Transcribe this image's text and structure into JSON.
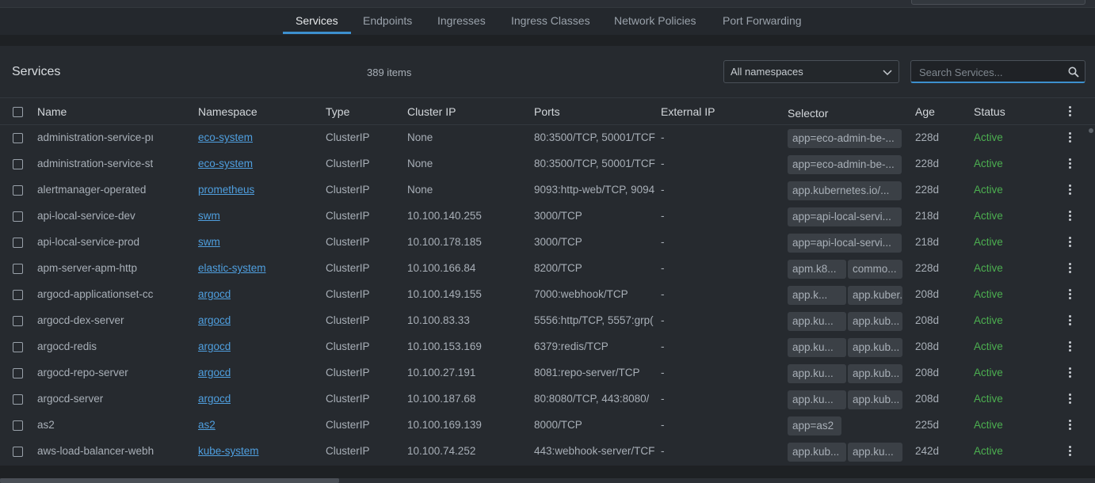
{
  "tabs": [
    {
      "label": "Services",
      "active": true
    },
    {
      "label": "Endpoints",
      "active": false
    },
    {
      "label": "Ingresses",
      "active": false
    },
    {
      "label": "Ingress Classes",
      "active": false
    },
    {
      "label": "Network Policies",
      "active": false
    },
    {
      "label": "Port Forwarding",
      "active": false
    }
  ],
  "toolbar": {
    "title": "Services",
    "count": "389 items",
    "namespace_select": "All namespaces",
    "search_placeholder": "Search Services..."
  },
  "table": {
    "columns": [
      "Name",
      "Namespace",
      "Type",
      "Cluster IP",
      "Ports",
      "External IP",
      "Selector",
      "Age",
      "Status"
    ],
    "rows": [
      {
        "name": "administration-service-pı",
        "namespace": "eco-system",
        "type": "ClusterIP",
        "cluster_ip": "None",
        "ports": "80:3500/TCP, 50001/TCF",
        "external_ip": "-",
        "selector": [
          "app=eco-admin-be-..."
        ],
        "age": "228d",
        "status": "Active"
      },
      {
        "name": "administration-service-st",
        "namespace": "eco-system",
        "type": "ClusterIP",
        "cluster_ip": "None",
        "ports": "80:3500/TCP, 50001/TCF",
        "external_ip": "-",
        "selector": [
          "app=eco-admin-be-..."
        ],
        "age": "228d",
        "status": "Active"
      },
      {
        "name": "alertmanager-operated",
        "namespace": "prometheus",
        "type": "ClusterIP",
        "cluster_ip": "None",
        "ports": "9093:http-web/TCP, 9094",
        "external_ip": "-",
        "selector": [
          "app.kubernetes.io/..."
        ],
        "age": "228d",
        "status": "Active"
      },
      {
        "name": "api-local-service-dev",
        "namespace": "swm",
        "type": "ClusterIP",
        "cluster_ip": "10.100.140.255",
        "ports": "3000/TCP",
        "external_ip": "-",
        "selector": [
          "app=api-local-servi..."
        ],
        "age": "218d",
        "status": "Active"
      },
      {
        "name": "api-local-service-prod",
        "namespace": "swm",
        "type": "ClusterIP",
        "cluster_ip": "10.100.178.185",
        "ports": "3000/TCP",
        "external_ip": "-",
        "selector": [
          "app=api-local-servi..."
        ],
        "age": "218d",
        "status": "Active"
      },
      {
        "name": "apm-server-apm-http",
        "namespace": "elastic-system",
        "type": "ClusterIP",
        "cluster_ip": "10.100.166.84",
        "ports": "8200/TCP",
        "external_ip": "-",
        "selector": [
          "apm.k8...",
          "commo..."
        ],
        "age": "228d",
        "status": "Active"
      },
      {
        "name": "argocd-applicationset-cc",
        "namespace": "argocd",
        "type": "ClusterIP",
        "cluster_ip": "10.100.149.155",
        "ports": "7000:webhook/TCP",
        "external_ip": "-",
        "selector": [
          "app.k...",
          "app.kuber..."
        ],
        "age": "208d",
        "status": "Active"
      },
      {
        "name": "argocd-dex-server",
        "namespace": "argocd",
        "type": "ClusterIP",
        "cluster_ip": "10.100.83.33",
        "ports": "5556:http/TCP, 5557:grp(",
        "external_ip": "-",
        "selector": [
          "app.ku...",
          "app.kub..."
        ],
        "age": "208d",
        "status": "Active"
      },
      {
        "name": "argocd-redis",
        "namespace": "argocd",
        "type": "ClusterIP",
        "cluster_ip": "10.100.153.169",
        "ports": "6379:redis/TCP",
        "external_ip": "-",
        "selector": [
          "app.ku...",
          "app.kub..."
        ],
        "age": "208d",
        "status": "Active"
      },
      {
        "name": "argocd-repo-server",
        "namespace": "argocd",
        "type": "ClusterIP",
        "cluster_ip": "10.100.27.191",
        "ports": "8081:repo-server/TCP",
        "external_ip": "-",
        "selector": [
          "app.ku...",
          "app.kub..."
        ],
        "age": "208d",
        "status": "Active"
      },
      {
        "name": "argocd-server",
        "namespace": "argocd",
        "type": "ClusterIP",
        "cluster_ip": "10.100.187.68",
        "ports": "80:8080/TCP, 443:8080/",
        "external_ip": "-",
        "selector": [
          "app.ku...",
          "app.kub..."
        ],
        "age": "208d",
        "status": "Active"
      },
      {
        "name": "as2",
        "namespace": "as2",
        "type": "ClusterIP",
        "cluster_ip": "10.100.169.139",
        "ports": "8000/TCP",
        "external_ip": "-",
        "selector": [
          "app=as2"
        ],
        "age": "225d",
        "status": "Active"
      },
      {
        "name": "aws-load-balancer-webh",
        "namespace": "kube-system",
        "type": "ClusterIP",
        "cluster_ip": "10.100.74.252",
        "ports": "443:webhook-server/TCF",
        "external_ip": "-",
        "selector": [
          "app.kub...",
          "app.ku..."
        ],
        "age": "242d",
        "status": "Active"
      }
    ]
  },
  "colors": {
    "accent": "#3d90ce",
    "link": "#4f9fdf",
    "status_active": "#4caf50"
  }
}
